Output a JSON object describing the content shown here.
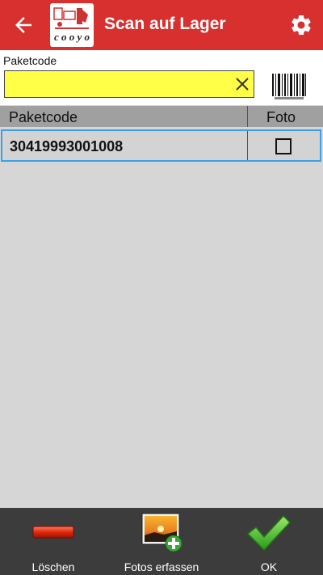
{
  "appbar": {
    "title": "Scan auf Lager",
    "color": "#d8302f"
  },
  "input": {
    "label": "Paketcode",
    "value": "",
    "placeholder": "",
    "background": "#ffff47"
  },
  "table": {
    "headers": [
      "Paketcode",
      "Foto"
    ],
    "rows": [
      {
        "code": "30419993001008",
        "foto_checked": false
      }
    ]
  },
  "bottom": {
    "delete_label": "Löschen",
    "photos_label": "Fotos erfassen",
    "ok_label": "OK"
  },
  "icons": [
    "back-arrow-icon",
    "app-logo-icon",
    "gear-icon",
    "clear-icon",
    "barcode-icon",
    "delete-icon",
    "add-photo-icon",
    "checkmark-icon"
  ]
}
